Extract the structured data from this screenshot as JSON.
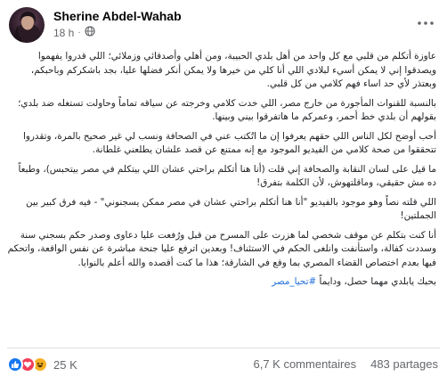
{
  "post": {
    "author": "Sherine Abdel-Wahab",
    "time": "18 h",
    "audience_icon": "globe-icon",
    "more_icon": "more-options-icon"
  },
  "paragraphs": [
    "عاوزة أتكلم من قلبي مع كل واحد من أهل بلدي الحبيبة، ومن أهلي وأصدقائي وزملائي؛ اللي قدروا يفهموا ويصدقوا إني لا يمكن أسيء لبلادي اللي أنا كلي من خيرها ولا يمكن أنكر فضلها عليا، بجد باشكركم وباحبكم، وبعتذر لأي حد اساء فهم كلامي من كل قلبي.",
    "بالنسبة للقنوات المأجورة من خارج مصر، اللي خدت كلامي وخرجته عن سياقه تماماً وحاولت تستغله ضد بلدي؛ بقولهم أن بلدي خط أحمر، وعمركم ما هاتفرقوا بيني وبينها.",
    "أحب أوضح لكل الناس اللي حقهم يعرفوا إن ما اتُكتب عني في الصحافة ونسب لي غير صحيح بالمرة، وتقدروا تتحققوا من صحة كلامي من الفيديو الموجود مع إنه ممتنع عن قصد علشان يطلعني غلطانة.",
    "ما قيل على لسان النقابة والصحافة إني قلت (أنا هنا أتكلم براحتي عشان اللي بيتكلم في مصر بيتحبس)، وطبعاً ده مش حقيقي، وماقلتهوش، لأن الكلمة بتفرق!",
    "اللي قلته نصاً وهو موجود بالفيديو \"أنا هنا أتكلم براحتي عشان في مصر ممكن يسجنوني\" - فيه فرق كبير بين الجملتين!",
    "أنا كنت بتكلم عن موقف شخصي لما هزرت على المسرح من قبل ورُفعت عليا دعاوى وصدر حكم بسجني سنة وسددت كفالة، واستأنفت وانلغى الحكم في الاستئناف! وبعدين اترفع عليا جنحة مباشرة عن نفس الواقعة، واتحكم فيها بعدم اختصاص القضاء المصري بما وقع في الشارقة؛ هذا ما كنت أقصده والله أعلم بالنوايا.",
    "بحبك يابلدي مهما حصل، ودايماً"
  ],
  "hashtag": "#تحيا_مصر",
  "reactions": {
    "count": "25 K",
    "types": [
      "like-icon",
      "love-icon",
      "haha-icon"
    ],
    "colors": {
      "like": "#1877f2",
      "love": "#f33e58",
      "haha": "#f7b125"
    }
  },
  "stats": {
    "comments": "6,7 K commentaires",
    "shares": "483 partages"
  }
}
